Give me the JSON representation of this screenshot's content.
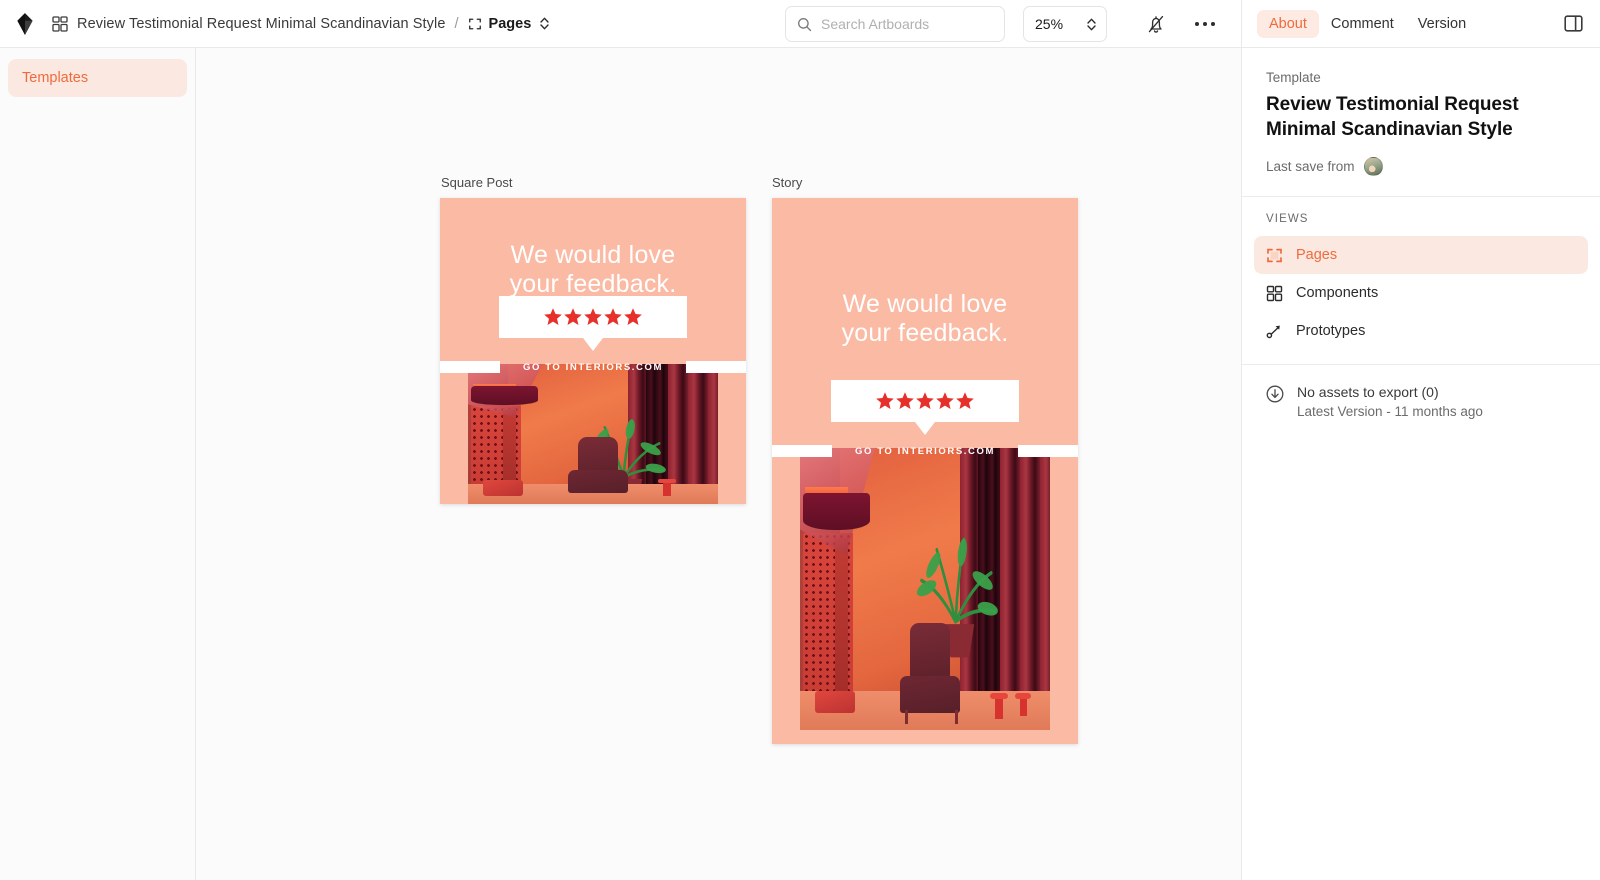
{
  "topbar": {
    "logo_icon": "sketch-diamond-logo",
    "pages_grid_icon": "grid-icon",
    "document_title": "Review Testimonial Request Minimal Scandinavian Style",
    "breadcrumb_separator": "/",
    "page_icon": "artboard-page-icon",
    "current_page": "Pages",
    "page_chevron_icon": "chevron-up-down-icon",
    "search": {
      "icon": "search-icon",
      "placeholder": "Search Artboards",
      "value": ""
    },
    "zoom": {
      "value": "25%",
      "stepper_icon": "chevron-up-down-icon"
    },
    "notifications_icon": "bell-slash-icon",
    "more_icon": "ellipsis-icon",
    "tabs": [
      {
        "label": "About",
        "active": true
      },
      {
        "label": "Comment",
        "active": false
      },
      {
        "label": "Version",
        "active": false
      }
    ],
    "panel_toggle_icon": "sidebar-toggle-icon"
  },
  "sidebar": {
    "items": [
      {
        "label": "Templates",
        "active": true
      }
    ]
  },
  "canvas": {
    "artboards": [
      {
        "name": "Square Post",
        "headline_line1": "We would love",
        "headline_line2": "your feedback.",
        "stars": 5,
        "cta": "GO TO INTERIORS.COM"
      },
      {
        "name": "Story",
        "headline_line1": "We would love",
        "headline_line2": "your feedback.",
        "stars": 5,
        "cta": "GO TO INTERIORS.COM"
      }
    ]
  },
  "right_panel": {
    "kicker": "Template",
    "title": "Review Testimonial Request Minimal Scandinavian Style",
    "last_save_label": "Last save from",
    "avatar_icon": "user-avatar",
    "views_heading": "VIEWS",
    "views": [
      {
        "label": "Pages",
        "icon": "artboard-page-icon",
        "active": true
      },
      {
        "label": "Components",
        "icon": "grid-icon",
        "active": false
      },
      {
        "label": "Prototypes",
        "icon": "prototype-flow-icon",
        "active": false
      }
    ],
    "export": {
      "icon": "download-circle-icon",
      "line1": "No assets to export (0)",
      "line2": "Latest Version - 11 months ago"
    }
  },
  "colors": {
    "accent": "#ef6b3e",
    "accent_bg": "#fbe9e1",
    "artboard_bg": "#fabaa4",
    "star": "#e8302a",
    "canvas_bg": "#fbfbfb"
  }
}
